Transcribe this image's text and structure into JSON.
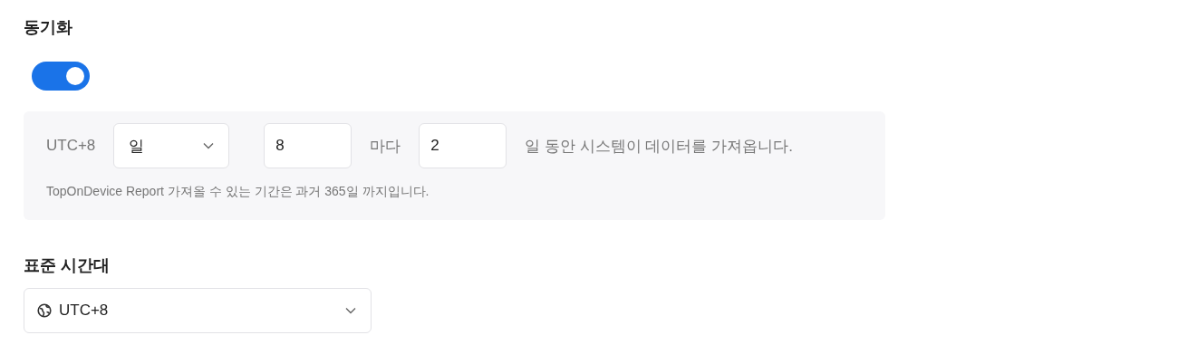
{
  "sync": {
    "title": "동기화",
    "toggle": {
      "on": true
    },
    "schedule": {
      "timezone_label": "UTC+8",
      "unit_select": {
        "value": "일"
      },
      "hour_input": {
        "value": "8"
      },
      "every_label": "마다",
      "days_input": {
        "value": "2"
      },
      "suffix": "일 동안 시스템이 데이터를 가져옵니다.",
      "hint": "TopOnDevice Report 가져올 수 있는 기간은 과거 365일 까지입니다."
    }
  },
  "timezone": {
    "title": "표준 시간대",
    "select": {
      "value": "UTC+8"
    }
  }
}
